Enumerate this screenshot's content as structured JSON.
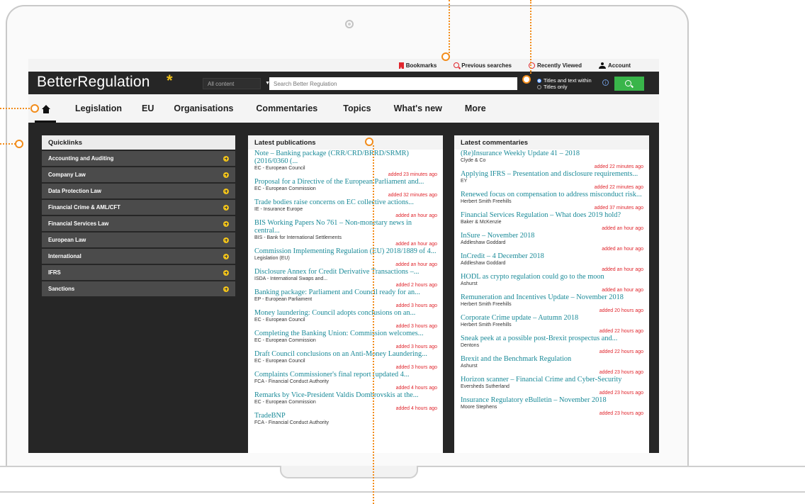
{
  "topbar": {
    "bookmarks": "Bookmarks",
    "previous_searches": "Previous searches",
    "recently_viewed": "Recently Viewed",
    "account": "Account"
  },
  "header": {
    "logo": "BetterRegulation",
    "logo_star": "*",
    "content_select": "All content",
    "search_placeholder": "Search Better Regulation",
    "scope_options": [
      "Titles and text within",
      "Titles only"
    ]
  },
  "nav": [
    "Legislation",
    "EU",
    "Organisations",
    "Commentaries",
    "Topics",
    "What's new",
    "More"
  ],
  "quicklinks": {
    "title": "Quicklinks",
    "items": [
      "Accounting and Auditing",
      "Company Law",
      "Data Protection Law",
      "Financial Crime & AML/CFT",
      "Financial Services Law",
      "European Law",
      "International",
      "IFRS",
      "Sanctions"
    ]
  },
  "publications": {
    "title": "Latest publications",
    "items": [
      {
        "title": "Note – Banking package (CRR/CRD/BRRD/SRMR) (2016/0360 (...",
        "source": "EC - European Council",
        "added": "added 23 minutes ago"
      },
      {
        "title": "Proposal for a Directive of the European Parliament and...",
        "source": "EC - European Commission",
        "added": "added 32 minutes ago"
      },
      {
        "title": "Trade bodies raise concerns on EC collective actions...",
        "source": "IE - Insurance Europe",
        "added": "added an hour ago"
      },
      {
        "title": "BIS Working Papers No 761 – Non-monetary news in central...",
        "source": "BIS - Bank for International Settlements",
        "added": "added an hour ago"
      },
      {
        "title": "Commission Implementing Regulation (EU) 2018/1889 of 4...",
        "source": "Legislation (EU)",
        "added": "added an hour ago"
      },
      {
        "title": "Disclosure Annex for Credit Derivative Transactions –...",
        "source": "ISDA - International Swaps and...",
        "added": "added 2 hours ago"
      },
      {
        "title": "Banking package: Parliament and Council ready for an...",
        "source": "EP - European Parliament",
        "added": "added 3 hours ago"
      },
      {
        "title": "Money laundering: Council adopts conclusions on an...",
        "source": "EC - European Council",
        "added": "added 3 hours ago"
      },
      {
        "title": "Completing the Banking Union: Commission welcomes...",
        "source": "EC - European Commission",
        "added": "added 3 hours ago"
      },
      {
        "title": "Draft Council conclusions on an Anti-Money Laundering...",
        "source": "EC - European Council",
        "added": "added 3 hours ago"
      },
      {
        "title": "Complaints Commissioner's final report (updated 4...",
        "source": "FCA - Financial Conduct Authority",
        "added": "added 4 hours ago"
      },
      {
        "title": "Remarks by Vice-President Valdis Dombrovskis at the...",
        "source": "EC - European Commission",
        "added": "added 4 hours ago"
      },
      {
        "title": "TradeBNP",
        "source": "FCA - Financial Conduct Authority",
        "added": ""
      }
    ]
  },
  "commentaries": {
    "title": "Latest commentaries",
    "items": [
      {
        "title": "(Re)Insurance Weekly Update 41 – 2018",
        "source": "Clyde & Co",
        "added": "added 22 minutes ago"
      },
      {
        "title": "Applying IFRS – Presentation and disclosure requirements...",
        "source": "EY",
        "added": "added 22 minutes ago"
      },
      {
        "title": "Renewed focus on compensation to address misconduct risk...",
        "source": "Herbert Smith Freehills",
        "added": "added 37 minutes ago"
      },
      {
        "title": "Financial Services Regulation – What does 2019 hold?",
        "source": "Baker & McKenzie",
        "added": "added an hour ago"
      },
      {
        "title": "InSure – November 2018",
        "source": "Addleshaw Goddard",
        "added": "added an hour ago"
      },
      {
        "title": "InCredit – 4 December 2018",
        "source": "Addleshaw Goddard",
        "added": "added an hour ago"
      },
      {
        "title": "HODL as crypto regulation could go to the moon",
        "source": "Ashurst",
        "added": "added an hour ago"
      },
      {
        "title": "Remuneration and Incentives Update – November 2018",
        "source": "Herbert Smith Freehills",
        "added": "added 20 hours ago"
      },
      {
        "title": "Corporate Crime update – Autumn 2018",
        "source": "Herbert Smith Freehills",
        "added": "added 22 hours ago"
      },
      {
        "title": "Sneak peek at a possible post-Brexit prospectus and...",
        "source": "Dentons",
        "added": "added 22 hours ago"
      },
      {
        "title": "Brexit and the Benchmark Regulation",
        "source": "Ashurst",
        "added": "added 23 hours ago"
      },
      {
        "title": "Horizon scanner – Financial Crime and Cyber-Security",
        "source": "Eversheds Sutherland",
        "added": "added 23 hours ago"
      },
      {
        "title": "Insurance Regulatory eBulletin – November 2018",
        "source": "Moore Stephens",
        "added": "added 23 hours ago"
      }
    ]
  },
  "colors": {
    "accent_star": "#f0c21a",
    "link": "#1a8a98",
    "timestamp": "#e0262d",
    "search_button": "#39b54a",
    "callout": "#f28c1b"
  }
}
